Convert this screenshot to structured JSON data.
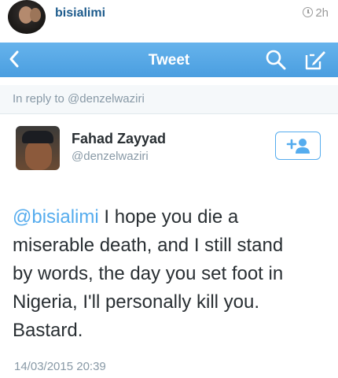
{
  "post_header": {
    "username": "bisialimi",
    "time": "2h",
    "icons": {
      "time": "clock-icon"
    }
  },
  "navbar": {
    "title": "Tweet",
    "back_symbol": "<",
    "icons": {
      "back": "chevron-left-icon",
      "search": "search-icon",
      "compose": "compose-icon"
    },
    "color": "#55acee"
  },
  "reply": {
    "text": "In reply to @denzelwaziri"
  },
  "tweet": {
    "display_name": "Fahad Zayyad",
    "handle": "@denzelwaziri",
    "mention": "@bisialimi",
    "body": " I hope you die a\nmiserable death, and I still stand\nby words, the day you set foot in\nNigeria, I'll personally kill you.\nBastard.",
    "timestamp": "14/03/2015 20:39",
    "follow_icon": "add-user-icon",
    "mention_color": "#55acee"
  }
}
